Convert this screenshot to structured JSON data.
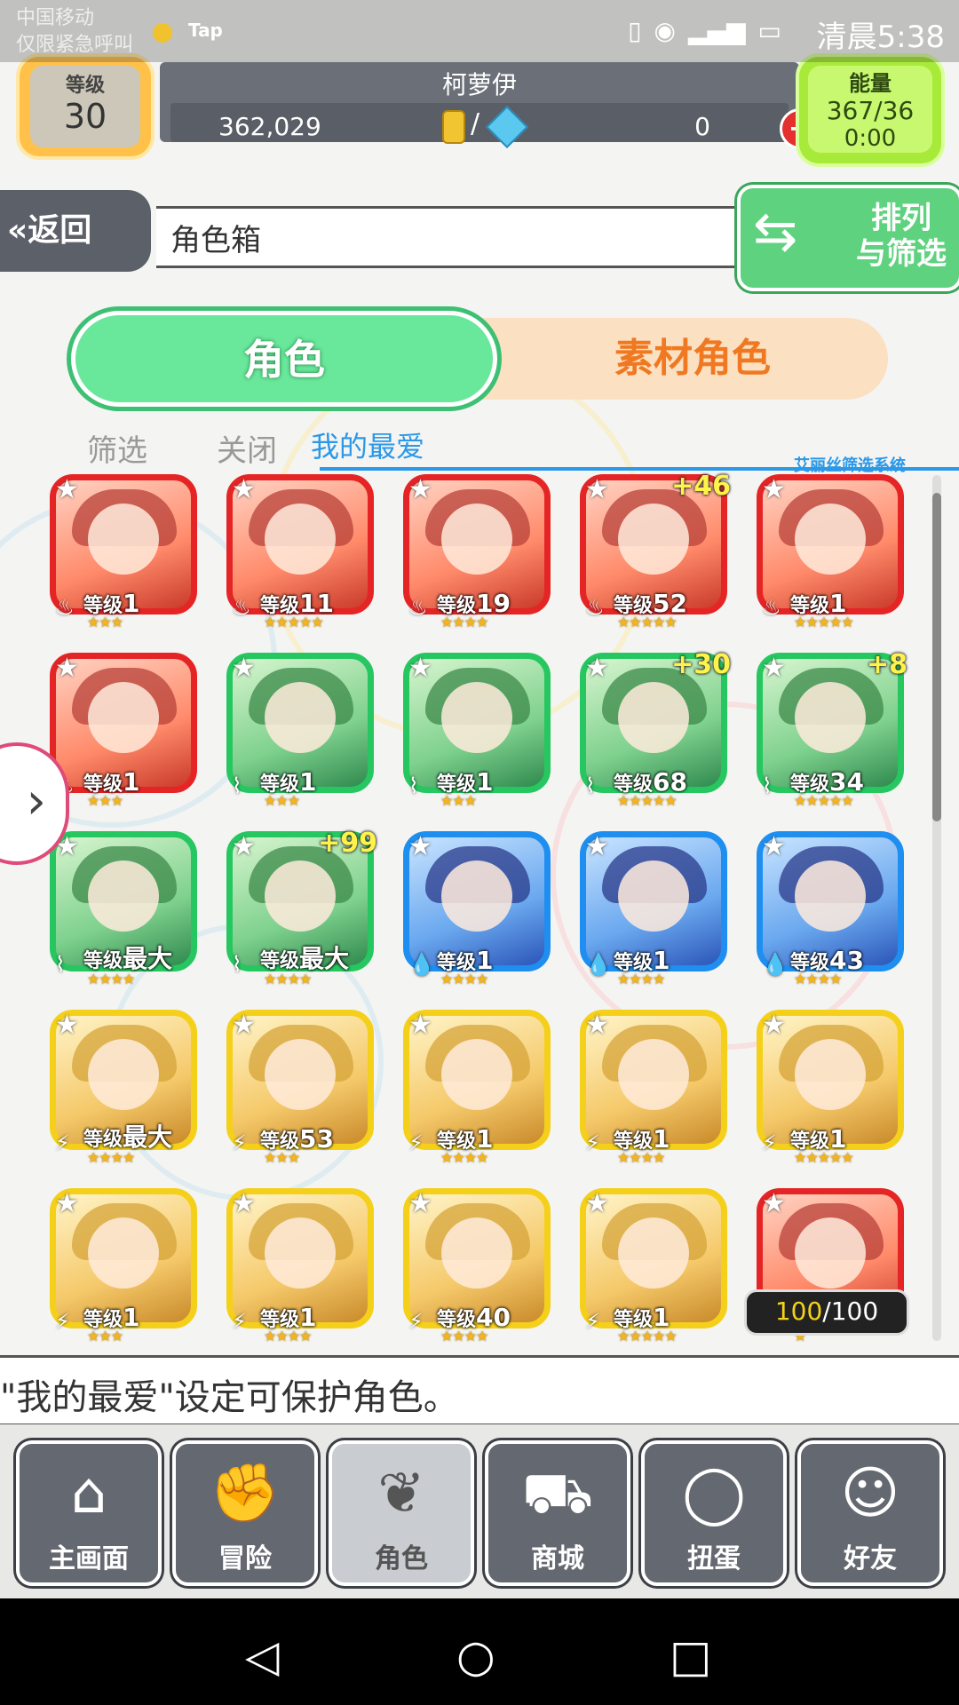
{
  "status_bar": {
    "carrier_line1": "中国移动",
    "carrier_line2": "仅限紧急呼叫",
    "app_label": "Tap",
    "time": "清晨5:38"
  },
  "header": {
    "level_label": "等级",
    "level_value": "30",
    "player_name": "柯萝伊",
    "coins": "362,029",
    "slash": "/",
    "gems": "0",
    "energy_label": "能量",
    "energy_value": "367/36",
    "energy_timer": "0:00"
  },
  "nav": {
    "back_label": "«返回",
    "page_title": "角色箱",
    "sort_label_line1": "排列",
    "sort_label_line2": "与筛选"
  },
  "tabs": {
    "characters": "角色",
    "material": "素材角色"
  },
  "filters": {
    "filter": "筛选",
    "close": "关闭",
    "favorites": "我的最爱",
    "system_label": "艾丽丝筛选系统"
  },
  "cards": [
    {
      "color": "red",
      "level_prefix": "等级",
      "level": "1",
      "bonus": "",
      "elem": "fire",
      "stars": "★★★"
    },
    {
      "color": "red",
      "level_prefix": "等级",
      "level": "11",
      "bonus": "",
      "elem": "fire",
      "stars": "★★★★★"
    },
    {
      "color": "red",
      "level_prefix": "等级",
      "level": "19",
      "bonus": "",
      "elem": "fire",
      "stars": "★★★★"
    },
    {
      "color": "red",
      "level_prefix": "等级",
      "level": "52",
      "bonus": "+46",
      "elem": "fire",
      "stars": "★★★★★"
    },
    {
      "color": "red",
      "level_prefix": "等级",
      "level": "1",
      "bonus": "",
      "elem": "fire",
      "stars": "★★★★★"
    },
    {
      "color": "red",
      "level_prefix": "等级",
      "level": "1",
      "bonus": "",
      "elem": "fire",
      "stars": "★★★"
    },
    {
      "color": "green",
      "level_prefix": "等级",
      "level": "1",
      "bonus": "",
      "elem": "wind",
      "stars": "★★★"
    },
    {
      "color": "green",
      "level_prefix": "等级",
      "level": "1",
      "bonus": "",
      "elem": "wind",
      "stars": "★★★"
    },
    {
      "color": "green",
      "level_prefix": "等级",
      "level": "68",
      "bonus": "+30",
      "elem": "wind",
      "stars": "★★★★★"
    },
    {
      "color": "green",
      "level_prefix": "等级",
      "level": "34",
      "bonus": "+8",
      "elem": "wind",
      "stars": "★★★★★"
    },
    {
      "color": "green",
      "level_prefix": "等级",
      "level": "最大",
      "bonus": "",
      "elem": "wind",
      "stars": "★★★★"
    },
    {
      "color": "green",
      "level_prefix": "等级",
      "level": "最大",
      "bonus": "+99",
      "elem": "wind",
      "stars": "★★★★"
    },
    {
      "color": "blue",
      "level_prefix": "等级",
      "level": "1",
      "bonus": "",
      "elem": "water",
      "stars": "★★★★"
    },
    {
      "color": "blue",
      "level_prefix": "等级",
      "level": "1",
      "bonus": "",
      "elem": "water",
      "stars": "★★★★"
    },
    {
      "color": "blue",
      "level_prefix": "等级",
      "level": "43",
      "bonus": "",
      "elem": "water",
      "stars": "★★★★"
    },
    {
      "color": "yellow",
      "level_prefix": "等级",
      "level": "最大",
      "bonus": "",
      "elem": "thunder",
      "stars": "★★★★"
    },
    {
      "color": "yellow",
      "level_prefix": "等级",
      "level": "53",
      "bonus": "",
      "elem": "thunder",
      "stars": "★★★"
    },
    {
      "color": "yellow",
      "level_prefix": "等级",
      "level": "1",
      "bonus": "",
      "elem": "thunder",
      "stars": "★★★★"
    },
    {
      "color": "yellow",
      "level_prefix": "等级",
      "level": "1",
      "bonus": "",
      "elem": "thunder",
      "stars": "★★★★"
    },
    {
      "color": "yellow",
      "level_prefix": "等级",
      "level": "1",
      "bonus": "",
      "elem": "thunder",
      "stars": "★★★★★"
    },
    {
      "color": "yellow",
      "level_prefix": "等级",
      "level": "1",
      "bonus": "",
      "elem": "thunder",
      "stars": "★★★"
    },
    {
      "color": "yellow",
      "level_prefix": "等级",
      "level": "1",
      "bonus": "",
      "elem": "thunder",
      "stars": "★★★★"
    },
    {
      "color": "yellow",
      "level_prefix": "等级",
      "level": "40",
      "bonus": "",
      "elem": "thunder",
      "stars": "★★★★"
    },
    {
      "color": "yellow",
      "level_prefix": "等级",
      "level": "1",
      "bonus": "",
      "elem": "thunder",
      "stars": "★★★★★"
    },
    {
      "color": "red",
      "level_prefix": "",
      "level": "",
      "bonus": "",
      "elem": "",
      "stars": "★"
    }
  ],
  "box_count": {
    "current": "100",
    "slash": "/",
    "max": "100"
  },
  "message": "\"我的最爱\"设定可保护角色。",
  "bottom_nav": [
    {
      "label": "主画面",
      "icon": "home-icon"
    },
    {
      "label": "冒险",
      "icon": "handshake-icon"
    },
    {
      "label": "角色",
      "icon": "bunny-icon"
    },
    {
      "label": "商城",
      "icon": "cart-icon"
    },
    {
      "label": "扭蛋",
      "icon": "egg-icon"
    },
    {
      "label": "好友",
      "icon": "friends-icon"
    }
  ]
}
